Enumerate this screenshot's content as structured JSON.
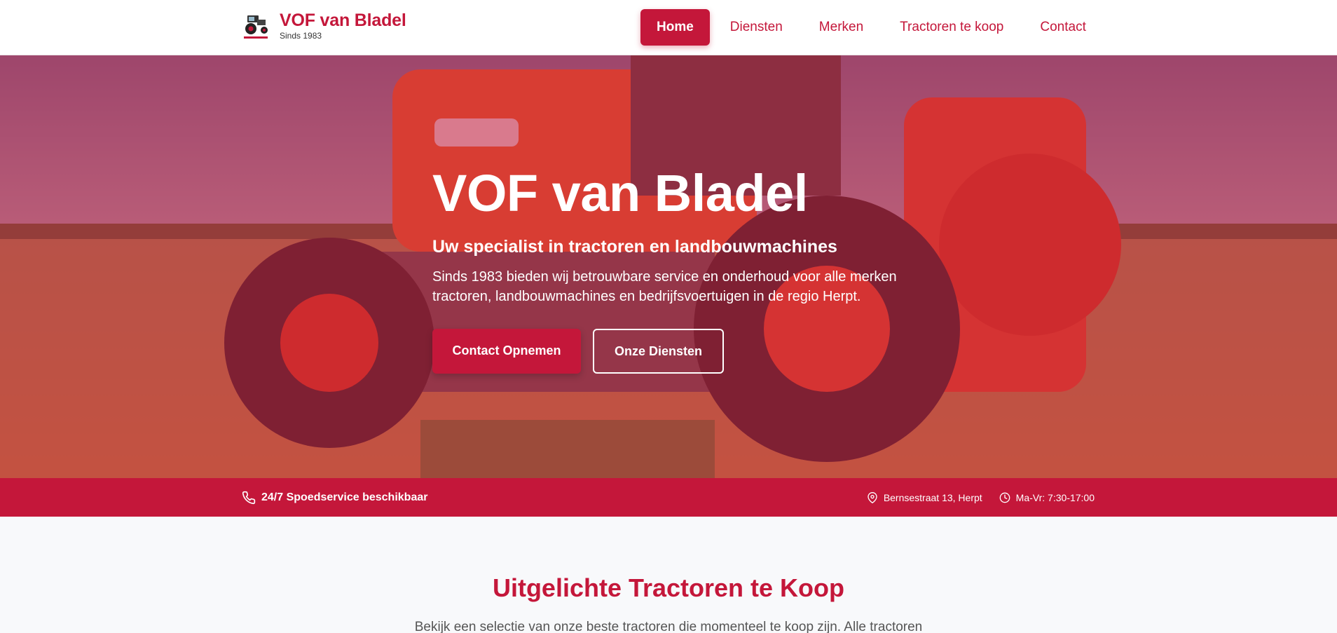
{
  "header": {
    "brand_name": "VOF van Bladel",
    "brand_since": "Sinds 1983",
    "logo_icon": "tractor-logo-icon",
    "nav": [
      {
        "label": "Home",
        "active": true
      },
      {
        "label": "Diensten",
        "active": false
      },
      {
        "label": "Merken",
        "active": false
      },
      {
        "label": "Tractoren te koop",
        "active": false
      },
      {
        "label": "Contact",
        "active": false
      }
    ]
  },
  "hero": {
    "title": "VOF van Bladel",
    "subtitle": "Uw specialist in tractoren en landbouwmachines",
    "description": "Sinds 1983 bieden wij betrouwbare service en onderhoud voor alle merken tractoren, landbouwmachines en bedrijfsvoertuigen in de regio Herpt.",
    "primary_button": "Contact Opnemen",
    "secondary_button": "Onze Diensten",
    "background_image": "orange-tractor-in-field"
  },
  "infobar": {
    "service": "24/7 Spoedservice beschikbaar",
    "address": "Bernsestraat 13, Herpt",
    "hours": "Ma-Vr: 7:30-17:00",
    "icons": [
      "phone-icon",
      "map-pin-icon",
      "clock-icon"
    ]
  },
  "featured": {
    "title": "Uitgelichte Tractoren te Koop",
    "description": "Bekijk een selectie van onze beste tractoren die momenteel te koop zijn. Alle tractoren"
  },
  "colors": {
    "accent": "#c4173a",
    "background": "#f8f9fb",
    "header_bg": "#ffffff"
  }
}
